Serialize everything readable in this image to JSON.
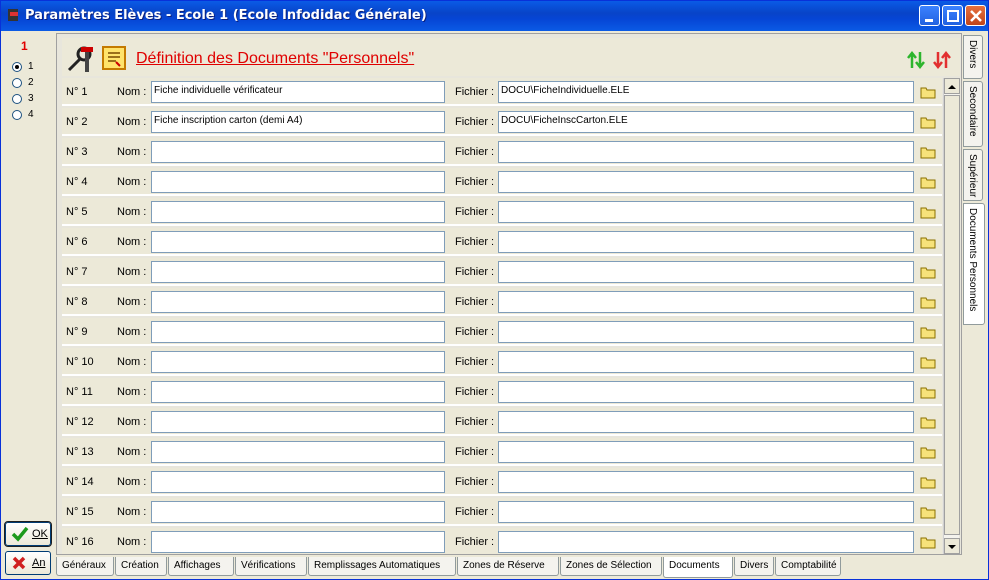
{
  "window": {
    "title": "Paramètres Elèves - Ecole 1 (Ecole Infodidac Générale)"
  },
  "left_panel": {
    "number": "1",
    "radios": [
      {
        "label": "1",
        "selected": true
      },
      {
        "label": "2",
        "selected": false
      },
      {
        "label": "3",
        "selected": false
      },
      {
        "label": "4",
        "selected": false
      }
    ],
    "ok_label": "OK",
    "cancel_label": "An"
  },
  "header": {
    "title": "Définition des Documents \"Personnels\""
  },
  "labels": {
    "nom": "Nom :",
    "fichier": "Fichier :"
  },
  "rows": [
    {
      "no": "N° 1",
      "nom": "Fiche individuelle vérificateur",
      "fichier": "DOCU\\FicheIndividuelle.ELE"
    },
    {
      "no": "N° 2",
      "nom": "Fiche inscription carton (demi A4)",
      "fichier": "DOCU\\FicheInscCarton.ELE"
    },
    {
      "no": "N° 3",
      "nom": "",
      "fichier": ""
    },
    {
      "no": "N° 4",
      "nom": "",
      "fichier": ""
    },
    {
      "no": "N° 5",
      "nom": "",
      "fichier": ""
    },
    {
      "no": "N° 6",
      "nom": "",
      "fichier": ""
    },
    {
      "no": "N° 7",
      "nom": "",
      "fichier": ""
    },
    {
      "no": "N° 8",
      "nom": "",
      "fichier": ""
    },
    {
      "no": "N° 9",
      "nom": "",
      "fichier": ""
    },
    {
      "no": "N° 10",
      "nom": "",
      "fichier": ""
    },
    {
      "no": "N° 11",
      "nom": "",
      "fichier": ""
    },
    {
      "no": "N° 12",
      "nom": "",
      "fichier": ""
    },
    {
      "no": "N° 13",
      "nom": "",
      "fichier": ""
    },
    {
      "no": "N° 14",
      "nom": "",
      "fichier": ""
    },
    {
      "no": "N° 15",
      "nom": "",
      "fichier": ""
    },
    {
      "no": "N° 16",
      "nom": "",
      "fichier": ""
    }
  ],
  "side_tabs": [
    {
      "label": "Divers",
      "active": false
    },
    {
      "label": "Secondaire",
      "active": false
    },
    {
      "label": "Supérieur",
      "active": false
    },
    {
      "label": "Documents Personnels",
      "active": true
    }
  ],
  "bottom_tabs": [
    {
      "label": "Généraux",
      "active": false
    },
    {
      "label": "Création",
      "active": false
    },
    {
      "label": "Affichages",
      "active": false
    },
    {
      "label": "Vérifications",
      "active": false
    },
    {
      "label": "Remplissages Automatiques",
      "active": false
    },
    {
      "label": "Zones de Réserve",
      "active": false
    },
    {
      "label": "Zones de Sélection",
      "active": false
    },
    {
      "label": "Documents",
      "active": true
    },
    {
      "label": "Divers",
      "active": false
    },
    {
      "label": "Comptabilité",
      "active": false
    }
  ],
  "colors": {
    "title_red": "#e00000",
    "sort_green": "#2db52d",
    "sort_red": "#e23030",
    "titlebar_blue": "#0a5be6"
  }
}
